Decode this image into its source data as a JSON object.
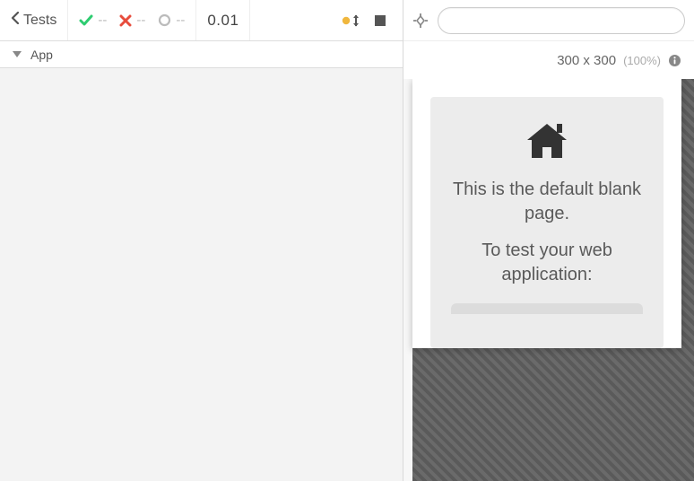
{
  "toolbar": {
    "back_label": "Tests",
    "passed": "--",
    "failed": "--",
    "pending": "--",
    "time": "0.01"
  },
  "sidebar": {
    "root_label": "App"
  },
  "preview": {
    "dimensions": "300 x 300",
    "zoom": "(100%)",
    "url": "",
    "blank_line1": "This is the default blank page.",
    "blank_line2": "To test your web application:"
  }
}
